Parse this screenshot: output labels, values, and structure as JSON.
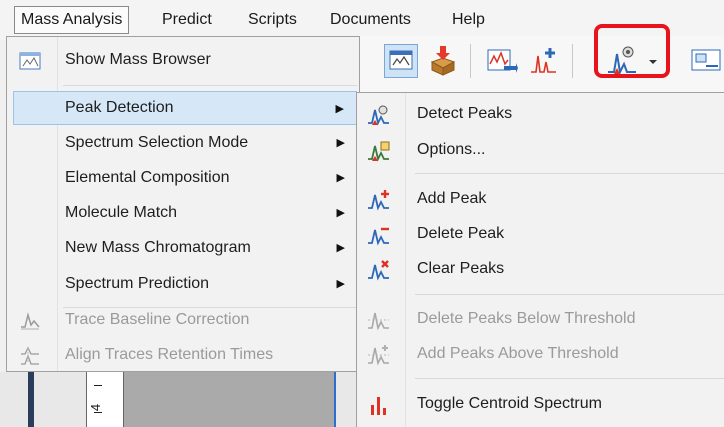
{
  "menubar": {
    "items": [
      {
        "label": "Mass Analysis",
        "active": true
      },
      {
        "label": "Predict"
      },
      {
        "label": "Scripts"
      },
      {
        "label": "Documents"
      },
      {
        "label": "Help"
      }
    ]
  },
  "main_menu": {
    "items": [
      {
        "label": "Show Mass Browser",
        "icon": "mass-browser-icon",
        "enabled": true,
        "submenu": false
      },
      {
        "label": "Peak Detection",
        "enabled": true,
        "submenu": true,
        "highlighted": true
      },
      {
        "label": "Spectrum Selection Mode",
        "enabled": true,
        "submenu": true
      },
      {
        "label": "Elemental Composition",
        "enabled": true,
        "submenu": true
      },
      {
        "label": "Molecule Match",
        "enabled": true,
        "submenu": true
      },
      {
        "label": "New Mass Chromatogram",
        "enabled": true,
        "submenu": true
      },
      {
        "label": "Spectrum Prediction",
        "enabled": true,
        "submenu": true
      },
      {
        "label": "Trace Baseline Correction",
        "icon": "baseline-correction-icon",
        "enabled": false
      },
      {
        "label": "Align Traces Retention Times",
        "icon": "align-traces-icon",
        "enabled": false
      }
    ]
  },
  "submenu": {
    "items": [
      {
        "label": "Detect Peaks",
        "icon": "detect-peaks-icon",
        "enabled": true
      },
      {
        "label": "Options...",
        "icon": "peak-options-icon",
        "enabled": true
      },
      {
        "label": "Add Peak",
        "icon": "add-peak-icon",
        "enabled": true
      },
      {
        "label": "Delete Peak",
        "icon": "delete-peak-icon",
        "enabled": true
      },
      {
        "label": "Clear Peaks",
        "icon": "clear-peaks-icon",
        "enabled": true
      },
      {
        "label": "Delete Peaks Below Threshold",
        "icon": "delete-below-threshold-icon",
        "enabled": false
      },
      {
        "label": "Add Peaks Above Threshold",
        "icon": "add-above-threshold-icon",
        "enabled": false
      },
      {
        "label": "Toggle Centroid Spectrum",
        "icon": "centroid-spectrum-icon",
        "enabled": true
      }
    ]
  },
  "toolbar": {
    "highlight_color": "#e8131b"
  },
  "background": {
    "axis_label": "4"
  }
}
